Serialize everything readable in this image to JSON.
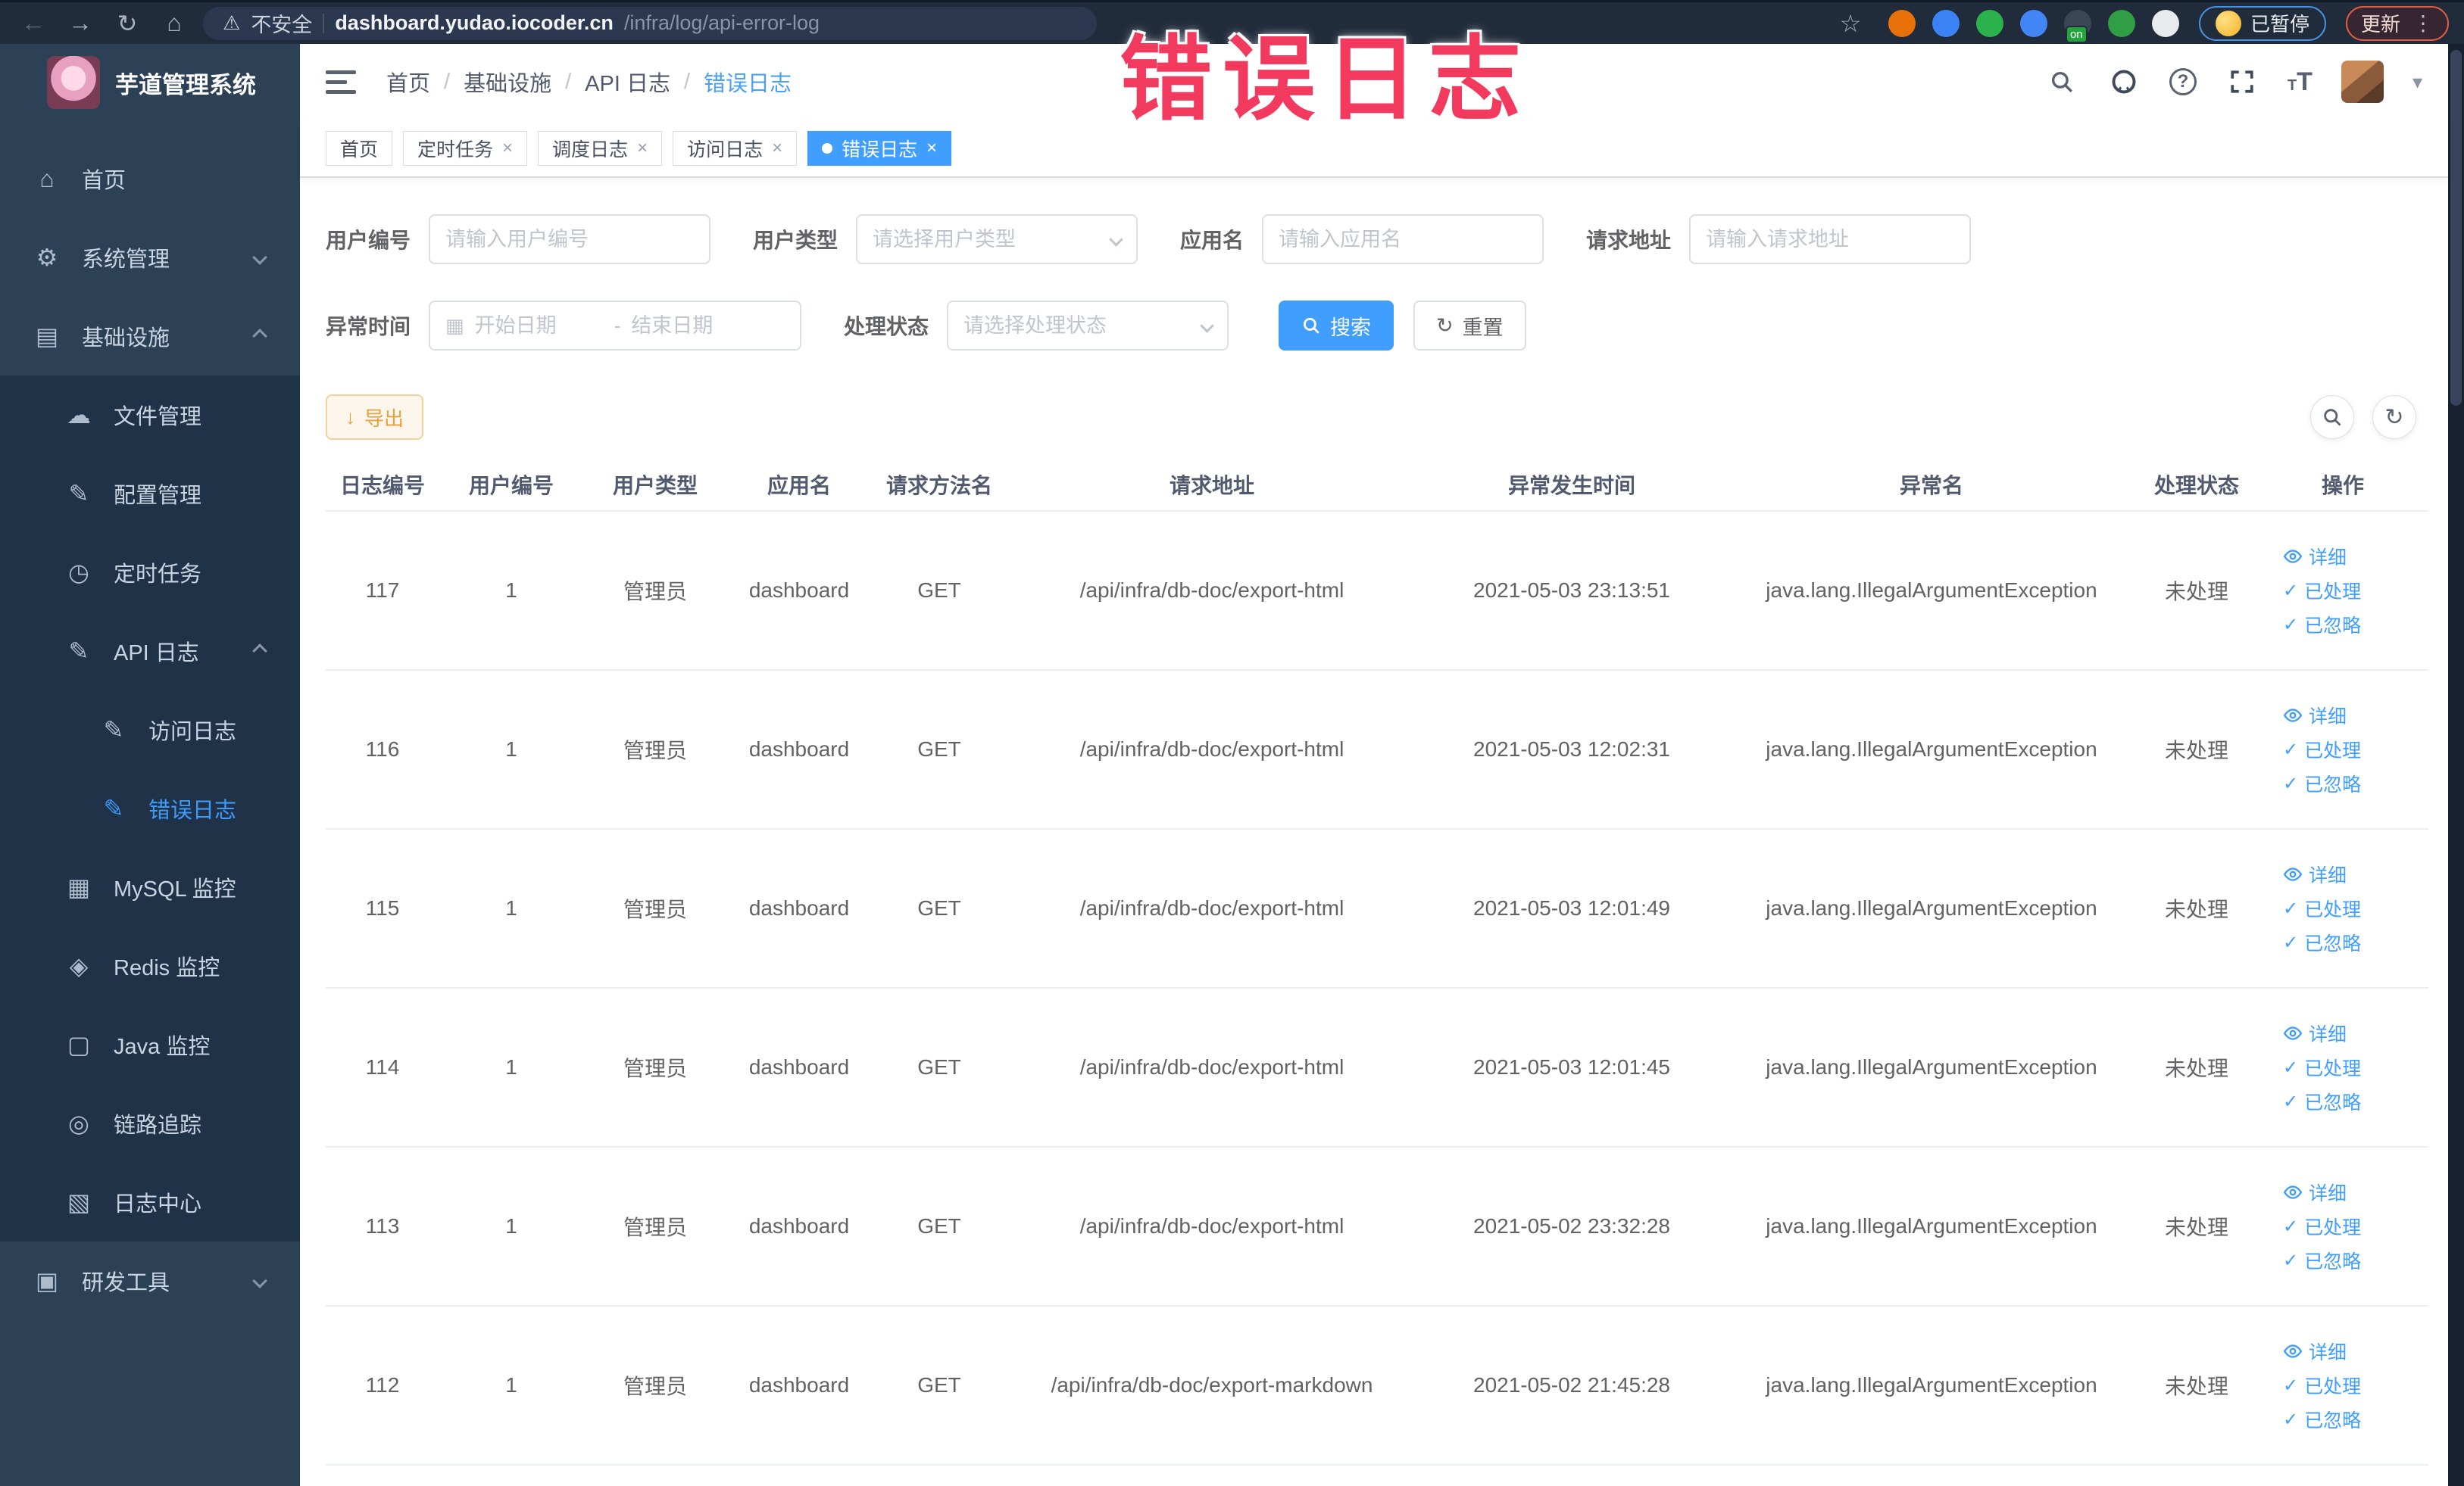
{
  "colors": {
    "accent": "#409EFF",
    "warning": "#e6a23c",
    "annotation": "#f23a5f",
    "sidebar_bg": "#2d4156",
    "sidebar_submenu_bg": "#1f3247",
    "browser_bar_bg": "#202b3b"
  },
  "browser": {
    "security_label": "不安全",
    "url_host": "dashboard.yudao.iocoder.cn",
    "url_path": "/infra/log/api-error-log",
    "extensions": [
      {
        "name": "extension-orange-icon",
        "color": "#e8710a",
        "badge": ""
      },
      {
        "name": "extension-shield-icon",
        "color": "#3b82f6",
        "badge": ""
      },
      {
        "name": "extension-green-check-icon",
        "color": "#2bb24c",
        "badge": ""
      },
      {
        "name": "extension-grid-icon",
        "color": "#4285f4",
        "badge": ""
      },
      {
        "name": "extension-switch-icon",
        "color": "#3a4556",
        "badge": "on"
      },
      {
        "name": "extension-leaf-icon",
        "color": "#2f9e44",
        "badge": ""
      },
      {
        "name": "extension-puzzle-icon",
        "color": "#e8eaed",
        "badge": ""
      }
    ],
    "paused_badge": "已暂停",
    "update_button": "更新"
  },
  "annotation": {
    "text": "错误日志"
  },
  "sidebar": {
    "title": "芋道管理系统",
    "items": [
      {
        "label": "首页",
        "icon": "home-icon",
        "glyph": "⌂",
        "level": 1,
        "sub": false,
        "arrow": "",
        "active": false
      },
      {
        "label": "系统管理",
        "icon": "gear-icon",
        "glyph": "⚙",
        "level": 1,
        "sub": false,
        "arrow": "down",
        "active": false
      },
      {
        "label": "基础设施",
        "icon": "infrastructure-icon",
        "glyph": "▤",
        "level": 1,
        "sub": false,
        "arrow": "up",
        "active": false
      },
      {
        "label": "文件管理",
        "icon": "file-manage-icon",
        "glyph": "☁",
        "level": 2,
        "sub": true,
        "arrow": "",
        "active": false
      },
      {
        "label": "配置管理",
        "icon": "config-manage-icon",
        "glyph": "✎",
        "level": 2,
        "sub": true,
        "arrow": "",
        "active": false
      },
      {
        "label": "定时任务",
        "icon": "scheduled-task-icon",
        "glyph": "◷",
        "level": 2,
        "sub": true,
        "arrow": "",
        "active": false
      },
      {
        "label": "API 日志",
        "icon": "api-log-icon",
        "glyph": "✎",
        "level": 2,
        "sub": true,
        "arrow": "up",
        "active": false
      },
      {
        "label": "访问日志",
        "icon": "access-log-icon",
        "glyph": "✎",
        "level": 3,
        "sub": true,
        "arrow": "",
        "active": false
      },
      {
        "label": "错误日志",
        "icon": "error-log-icon",
        "glyph": "✎",
        "level": 3,
        "sub": true,
        "arrow": "",
        "active": true
      },
      {
        "label": "MySQL 监控",
        "icon": "mysql-monitor-icon",
        "glyph": "▦",
        "level": 2,
        "sub": true,
        "arrow": "",
        "active": false
      },
      {
        "label": "Redis 监控",
        "icon": "redis-monitor-icon",
        "glyph": "◈",
        "level": 2,
        "sub": true,
        "arrow": "",
        "active": false
      },
      {
        "label": "Java 监控",
        "icon": "java-monitor-icon",
        "glyph": "▢",
        "level": 2,
        "sub": true,
        "arrow": "",
        "active": false
      },
      {
        "label": "链路追踪",
        "icon": "trace-icon",
        "glyph": "◎",
        "level": 2,
        "sub": true,
        "arrow": "",
        "active": false
      },
      {
        "label": "日志中心",
        "icon": "log-center-icon",
        "glyph": "▧",
        "level": 2,
        "sub": true,
        "arrow": "",
        "active": false
      },
      {
        "label": "研发工具",
        "icon": "dev-tools-icon",
        "glyph": "▣",
        "level": 1,
        "sub": false,
        "arrow": "down",
        "active": false
      }
    ]
  },
  "header": {
    "breadcrumb": [
      "首页",
      "基础设施",
      "API 日志"
    ],
    "breadcrumb_current": "错误日志"
  },
  "tabs": [
    {
      "label": "首页",
      "closable": false,
      "active": false
    },
    {
      "label": "定时任务",
      "closable": true,
      "active": false
    },
    {
      "label": "调度日志",
      "closable": true,
      "active": false
    },
    {
      "label": "访问日志",
      "closable": true,
      "active": false
    },
    {
      "label": "错误日志",
      "closable": true,
      "active": true
    }
  ],
  "filters": {
    "row1": [
      {
        "label": "用户编号",
        "placeholder": "请输入用户编号",
        "type": "input"
      },
      {
        "label": "用户类型",
        "placeholder": "请选择用户类型",
        "type": "select"
      },
      {
        "label": "应用名",
        "placeholder": "请输入应用名",
        "type": "input"
      },
      {
        "label": "请求地址",
        "placeholder": "请输入请求地址",
        "type": "input"
      }
    ],
    "date": {
      "label": "异常时间",
      "start_placeholder": "开始日期",
      "separator": "-",
      "end_placeholder": "结束日期"
    },
    "status": {
      "label": "处理状态",
      "placeholder": "请选择处理状态"
    },
    "search_button": "搜索",
    "reset_button": "重置"
  },
  "toolbar": {
    "export_button": "导出"
  },
  "table": {
    "columns": [
      "日志编号",
      "用户编号",
      "用户类型",
      "应用名",
      "请求方法名",
      "请求地址",
      "异常发生时间",
      "异常名",
      "处理状态",
      "操作"
    ],
    "row_actions": [
      "详细",
      "已处理",
      "已忽略"
    ],
    "rows": [
      {
        "id": "117",
        "user_id": "1",
        "user_type": "管理员",
        "app": "dashboard",
        "method": "GET",
        "url": "/api/infra/db-doc/export-html",
        "time": "2021-05-03 23:13:51",
        "exception": "java.lang.IllegalArgumentException",
        "status": "未处理"
      },
      {
        "id": "116",
        "user_id": "1",
        "user_type": "管理员",
        "app": "dashboard",
        "method": "GET",
        "url": "/api/infra/db-doc/export-html",
        "time": "2021-05-03 12:02:31",
        "exception": "java.lang.IllegalArgumentException",
        "status": "未处理"
      },
      {
        "id": "115",
        "user_id": "1",
        "user_type": "管理员",
        "app": "dashboard",
        "method": "GET",
        "url": "/api/infra/db-doc/export-html",
        "time": "2021-05-03 12:01:49",
        "exception": "java.lang.IllegalArgumentException",
        "status": "未处理"
      },
      {
        "id": "114",
        "user_id": "1",
        "user_type": "管理员",
        "app": "dashboard",
        "method": "GET",
        "url": "/api/infra/db-doc/export-html",
        "time": "2021-05-03 12:01:45",
        "exception": "java.lang.IllegalArgumentException",
        "status": "未处理"
      },
      {
        "id": "113",
        "user_id": "1",
        "user_type": "管理员",
        "app": "dashboard",
        "method": "GET",
        "url": "/api/infra/db-doc/export-html",
        "time": "2021-05-02 23:32:28",
        "exception": "java.lang.IllegalArgumentException",
        "status": "未处理"
      },
      {
        "id": "112",
        "user_id": "1",
        "user_type": "管理员",
        "app": "dashboard",
        "method": "GET",
        "url": "/api/infra/db-doc/export-markdown",
        "time": "2021-05-02 21:45:28",
        "exception": "java.lang.IllegalArgumentException",
        "status": "未处理"
      }
    ]
  }
}
